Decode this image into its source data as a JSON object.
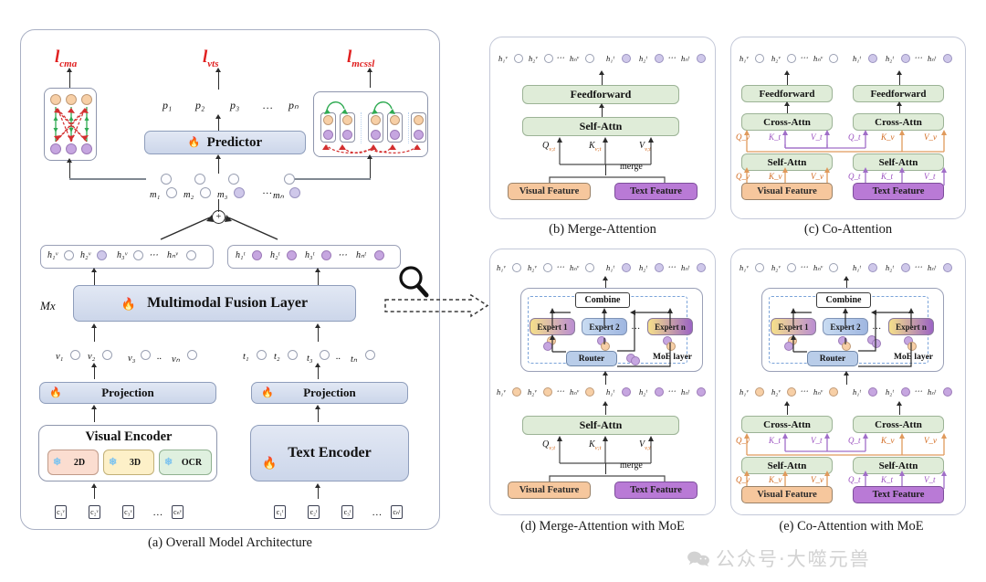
{
  "figure": {
    "title": "Multimodal fusion architecture variants",
    "panels": [
      {
        "id": "a",
        "caption": "(a) Overall Model Architecture"
      },
      {
        "id": "b",
        "caption": "(b) Merge-Attention"
      },
      {
        "id": "c",
        "caption": "(c) Co-Attention"
      },
      {
        "id": "d",
        "caption": "(d) Merge-Attention with MoE"
      },
      {
        "id": "e",
        "caption": "(e) Co-Attention with MoE"
      }
    ]
  },
  "panel_a": {
    "losses": {
      "cma": "l_cma",
      "vts": "l_vts",
      "mcssl": "l_mcssl"
    },
    "loss_display": {
      "cma_base": "l",
      "cma_sub": "cma",
      "vts_base": "l",
      "vts_sub": "vts",
      "mcssl_base": "l",
      "mcssl_sub": "mcssl"
    },
    "predictor_label": "Predictor",
    "fusion_label": "Multimodal Fusion Layer",
    "fusion_repeat": "Mx",
    "projection_label": "Projection",
    "visual_encoder_label": "Visual Encoder",
    "text_encoder_label": "Text Encoder",
    "visual_encoder_submodules": [
      "2D",
      "3D",
      "OCR"
    ],
    "p_tokens": [
      "p₁",
      "p₂",
      "p₃",
      "…",
      "pₙ"
    ],
    "m_tokens": [
      "m₁",
      "m₂",
      "m₃",
      "…",
      "mₙ"
    ],
    "v_tokens": [
      "v₁",
      "v₂",
      "v₃",
      "..",
      "vₙ"
    ],
    "t_tokens": [
      "t₁",
      "t₂",
      "t₃",
      "..",
      "tₙ"
    ],
    "hv_tokens": [
      "h₁ᵛ",
      "h₂ᵛ",
      "h₃ᵛ",
      "⋯",
      "hₙᵛ"
    ],
    "ht_tokens": [
      "h₁ᵗ",
      "h₂ᵗ",
      "h₃ᵗ",
      "⋯",
      "hₙᵗ"
    ],
    "cv_tokens": [
      "c₁ᵛ",
      "c₂ᵛ",
      "c₃ᵛ",
      "…",
      "cₙᵛ"
    ],
    "ct_tokens": [
      "c₁ᵗ",
      "c₂ᵗ",
      "c₃ᵗ",
      "…",
      "cₙᵗ"
    ],
    "plus_symbol": "+",
    "icons": {
      "trainable": "flame-icon",
      "frozen": "snowflake-icon",
      "zoom": "magnifier-icon"
    }
  },
  "panel_b": {
    "out_tokens_v": [
      "h₁ᵛ",
      "h₂ᵛ",
      "⋯",
      "hₙᵛ"
    ],
    "out_tokens_t": [
      "h₁ᵗ",
      "h₂ᵗ",
      "⋯",
      "hₙᵗ"
    ],
    "blocks": [
      "Feedforward",
      "Self-Attn"
    ],
    "qkv": [
      "Q",
      "K",
      "V"
    ],
    "qkv_sub": "v;t",
    "merge_label": "merge",
    "visual_feature": "Visual Feature",
    "text_feature": "Text Feature"
  },
  "panel_c": {
    "out_tokens_v": [
      "h₁ᵛ",
      "h₂ᵛ",
      "⋯",
      "hₙᵛ"
    ],
    "out_tokens_t": [
      "h₁ᵗ",
      "h₂ᵗ",
      "⋯",
      "hₙᵗ"
    ],
    "left_blocks": [
      "Feedforward",
      "Cross-Attn",
      "Self-Attn"
    ],
    "right_blocks": [
      "Feedforward",
      "Cross-Attn",
      "Self-Attn"
    ],
    "left_cross_qkv": [
      "Q_v",
      "K_t",
      "V_t"
    ],
    "right_cross_qkv": [
      "Q_t",
      "K_v",
      "V_v"
    ],
    "left_self_qkv": [
      "Q_v",
      "K_v",
      "V_v"
    ],
    "right_self_qkv": [
      "Q_t",
      "K_t",
      "V_t"
    ],
    "visual_feature": "Visual Feature",
    "text_feature": "Text Feature"
  },
  "panel_d": {
    "out_tokens_v": [
      "h₁ᵛ",
      "h₂ᵛ",
      "⋯",
      "hₙᵛ"
    ],
    "out_tokens_t": [
      "h₁ᵗ",
      "h₂ᵗ",
      "⋯",
      "hₙᵗ"
    ],
    "mid_tokens_v": [
      "h₁ᵛ",
      "h₂ᵛ",
      "⋯",
      "hₙᵛ"
    ],
    "mid_tokens_t": [
      "h₁ᵗ",
      "h₂ᵗ",
      "⋯",
      "hₙᵗ"
    ],
    "combine_label": "Combine",
    "experts": [
      "Expert 1",
      "Expert 2",
      "…",
      "Expert n"
    ],
    "router_label": "Router",
    "moe_label": "MoE layer",
    "attn_label": "Self-Attn",
    "qkv": [
      "Q",
      "K",
      "V"
    ],
    "qkv_sub": "v;t",
    "merge_label": "merge",
    "visual_feature": "Visual Feature",
    "text_feature": "Text Feature"
  },
  "panel_e": {
    "out_tokens_v": [
      "h₁ᵛ",
      "h₂ᵛ",
      "⋯",
      "hₙᵛ"
    ],
    "out_tokens_t": [
      "h₁ᵗ",
      "h₂ᵗ",
      "⋯",
      "hₙᵗ"
    ],
    "mid_tokens_v": [
      "h₁ᵛ",
      "h₂ᵛ",
      "⋯",
      "hₙᵛ"
    ],
    "mid_tokens_t": [
      "h₁ᵗ",
      "h₂ᵗ",
      "⋯",
      "hₙᵗ"
    ],
    "combine_label": "Combine",
    "experts": [
      "Expert 1",
      "Expert 2",
      "…",
      "Expert n"
    ],
    "router_label": "Router",
    "moe_label": "MoE layer",
    "left_blocks": [
      "Cross-Attn",
      "Self-Attn"
    ],
    "right_blocks": [
      "Cross-Attn",
      "Self-Attn"
    ],
    "left_cross_qkv": [
      "Q_v",
      "K_t",
      "V_t"
    ],
    "right_cross_qkv": [
      "Q_t",
      "K_v",
      "V_v"
    ],
    "left_self_qkv": [
      "Q_v",
      "K_v",
      "V_v"
    ],
    "right_self_qkv": [
      "Q_t",
      "K_t",
      "V_t"
    ],
    "visual_feature": "Visual Feature",
    "text_feature": "Text Feature"
  },
  "watermark": {
    "text": "公众号·大噬元兽",
    "icon": "wechat-icon"
  },
  "colors": {
    "visual_feature": "#f6c79d",
    "text_feature": "#b97ad6",
    "attn_block": "#dfecd8",
    "fusion_block": "#d6dfee",
    "router": "#b9cde9",
    "loss_text": "#e02020",
    "panel_border": "#a9b0c4",
    "orange_arrow": "#e09a5c",
    "purple_arrow": "#a06ec8",
    "green_arrow": "#2faa52",
    "red_arrow": "#d32f2f"
  }
}
